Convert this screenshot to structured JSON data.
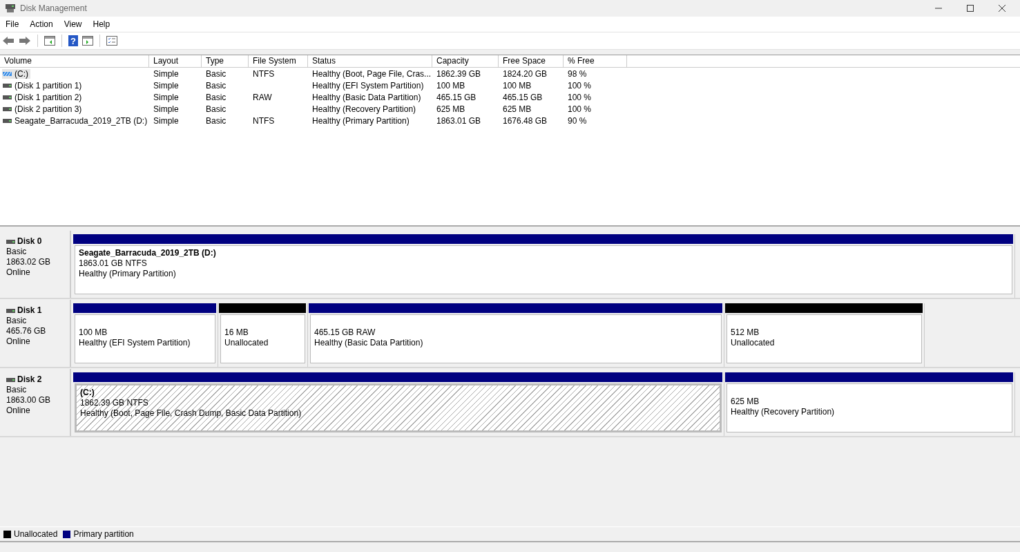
{
  "window": {
    "title": "Disk Management"
  },
  "menu": [
    "File",
    "Action",
    "View",
    "Help"
  ],
  "toolbar": {
    "help_glyph": "?"
  },
  "table": {
    "columns": [
      "Volume",
      "Layout",
      "Type",
      "File System",
      "Status",
      "Capacity",
      "Free Space",
      "% Free"
    ],
    "rows": [
      {
        "selected": true,
        "kind": "system",
        "cells": [
          "(C:)",
          "Simple",
          "Basic",
          "NTFS",
          "Healthy (Boot, Page File, Cras...",
          "1862.39 GB",
          "1824.20 GB",
          "98 %"
        ]
      },
      {
        "selected": false,
        "kind": "disk",
        "cells": [
          "(Disk 1 partition 1)",
          "Simple",
          "Basic",
          "",
          "Healthy (EFI System Partition)",
          "100 MB",
          "100 MB",
          "100 %"
        ]
      },
      {
        "selected": false,
        "kind": "disk",
        "cells": [
          "(Disk 1 partition 2)",
          "Simple",
          "Basic",
          "RAW",
          "Healthy (Basic Data Partition)",
          "465.15 GB",
          "465.15 GB",
          "100 %"
        ]
      },
      {
        "selected": false,
        "kind": "disk",
        "cells": [
          "(Disk 2 partition 3)",
          "Simple",
          "Basic",
          "",
          "Healthy (Recovery Partition)",
          "625 MB",
          "625 MB",
          "100 %"
        ]
      },
      {
        "selected": false,
        "kind": "disk",
        "cells": [
          "Seagate_Barracuda_2019_2TB (D:)",
          "Simple",
          "Basic",
          "NTFS",
          "Healthy (Primary Partition)",
          "1863.01 GB",
          "1676.48 GB",
          "90 %"
        ]
      }
    ]
  },
  "disks": [
    {
      "name": "Disk 0",
      "type": "Basic",
      "size": "1863.02 GB",
      "state": "Online",
      "partitions": [
        {
          "kind": "primary",
          "selected": false,
          "name": "Seagate_Barracuda_2019_2TB  (D:)",
          "size": "1863.01 GB NTFS",
          "status": "Healthy (Primary Partition)"
        }
      ]
    },
    {
      "name": "Disk 1",
      "type": "Basic",
      "size": "465.76 GB",
      "state": "Online",
      "partitions": [
        {
          "kind": "primary",
          "selected": false,
          "size": "100 MB",
          "status": "Healthy (EFI System Partition)"
        },
        {
          "kind": "unallocated",
          "selected": false,
          "size": "16 MB",
          "status": "Unallocated"
        },
        {
          "kind": "primary",
          "selected": false,
          "size": "465.15 GB RAW",
          "status": "Healthy (Basic Data Partition)"
        },
        {
          "kind": "unallocated",
          "selected": false,
          "size": "512 MB",
          "status": "Unallocated"
        }
      ]
    },
    {
      "name": "Disk 2",
      "type": "Basic",
      "size": "1863.00 GB",
      "state": "Online",
      "partitions": [
        {
          "kind": "primary",
          "selected": true,
          "name": "(C:)",
          "size": "1862.39 GB NTFS",
          "status": "Healthy (Boot, Page File, Crash Dump, Basic Data Partition)"
        },
        {
          "kind": "primary",
          "selected": false,
          "size": "625 MB",
          "status": "Healthy (Recovery Partition)"
        }
      ]
    }
  ],
  "legend": [
    {
      "label": "Unallocated",
      "color": "#000000"
    },
    {
      "label": "Primary partition",
      "color": "#000080"
    }
  ]
}
